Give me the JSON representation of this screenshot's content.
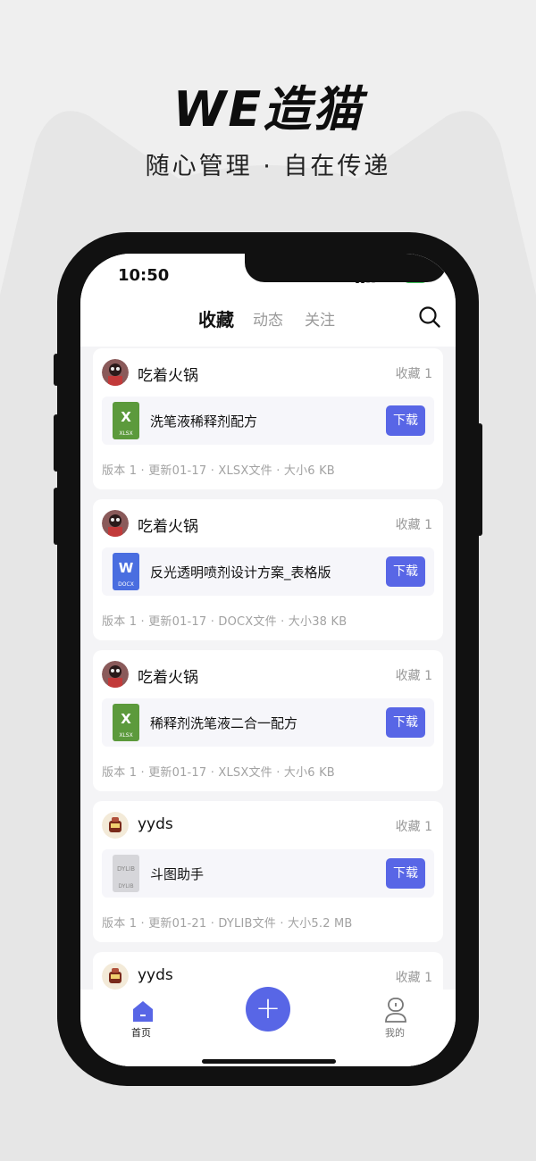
{
  "promo": {
    "title": "WE造猫",
    "subtitle": "随心管理 · 自在传递"
  },
  "status_bar": {
    "time": "10:50",
    "network": "4G",
    "battery": "80"
  },
  "tabs": [
    {
      "label": "收藏",
      "active": true
    },
    {
      "label": "动态",
      "active": false
    },
    {
      "label": "关注",
      "active": false
    }
  ],
  "cards": [
    {
      "user": "吃着火锅",
      "fav": "收藏 1",
      "file": {
        "name": "洗笔液稀释剂配方",
        "type_letter": "X",
        "ext": "XLSX",
        "color": "#5c9a3c"
      },
      "download": "下载",
      "meta": "版本 1 · 更新01-17 · XLSX文件 · 大小6 KB"
    },
    {
      "user": "吃着火锅",
      "fav": "收藏 1",
      "file": {
        "name": "反光透明喷剂设计方案_表格版",
        "type_letter": "W",
        "ext": "DOCX",
        "color": "#4a6ee0"
      },
      "download": "下载",
      "meta": "版本 1 · 更新01-17 · DOCX文件 · 大小38 KB"
    },
    {
      "user": "吃着火锅",
      "fav": "收藏 1",
      "file": {
        "name": "稀释剂洗笔液二合一配方",
        "type_letter": "X",
        "ext": "XLSX",
        "color": "#5c9a3c"
      },
      "download": "下载",
      "meta": "版本 1 · 更新01-17 · XLSX文件 · 大小6 KB"
    },
    {
      "user": "yyds",
      "fav": "收藏 1",
      "file": {
        "name": "斗图助手",
        "type_letter": "DYLIB",
        "ext": "DYLIB",
        "color": "#d6d6da"
      },
      "download": "下载",
      "meta": "版本 1 · 更新01-21 · DYLIB文件 · 大小5.2 MB"
    },
    {
      "user": "yyds",
      "fav": "收藏 1"
    }
  ],
  "bottom_nav": {
    "home": "首页",
    "add": "+",
    "me": "我的"
  },
  "colors": {
    "accent": "#5866e6",
    "xlsx": "#5c9a3c",
    "docx": "#4a6ee0",
    "battery": "#3fc55a"
  }
}
